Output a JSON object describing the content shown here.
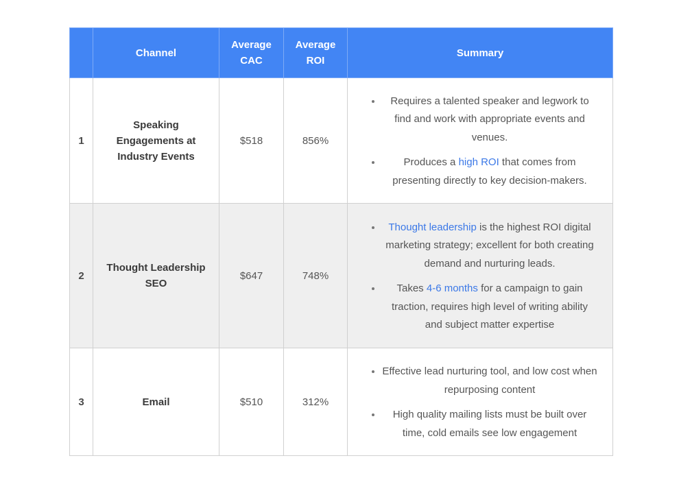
{
  "table": {
    "headers": {
      "rank": "",
      "channel": "Channel",
      "cac_line1": "Average",
      "cac_line2": "CAC",
      "roi_line1": "Average",
      "roi_line2": "ROI",
      "summary": "Summary"
    },
    "rows": [
      {
        "rank": "1",
        "channel": "Speaking Engagements at Industry Events",
        "cac": "$518",
        "roi": "856%",
        "bullets": [
          {
            "before": "Requires a talented speaker and legwork to find and work with appropriate events and venues.",
            "link": "",
            "after": ""
          },
          {
            "before": "Produces a ",
            "link": "high ROI",
            "after": " that comes from presenting directly to key decision-makers."
          }
        ]
      },
      {
        "rank": "2",
        "channel": "Thought Leadership SEO",
        "cac": "$647",
        "roi": "748%",
        "bullets": [
          {
            "before": "",
            "link": "Thought leadership",
            "after": " is the highest ROI digital marketing strategy; excellent for both creating demand and nurturing leads."
          },
          {
            "before": "Takes ",
            "link": "4-6 months",
            "after": " for a campaign to gain traction, requires high level of writing ability and subject matter expertise"
          }
        ]
      },
      {
        "rank": "3",
        "channel": "Email",
        "cac": "$510",
        "roi": "312%",
        "bullets": [
          {
            "before": "Effective lead nurturing tool, and low cost when repurposing content",
            "link": "",
            "after": ""
          },
          {
            "before": "High quality mailing lists must be built over time, cold emails see low engagement",
            "link": "",
            "after": ""
          }
        ]
      }
    ],
    "colors": {
      "header_bg": "#4285f4",
      "alt_row_bg": "#efefef",
      "link": "#3b78e7"
    }
  }
}
